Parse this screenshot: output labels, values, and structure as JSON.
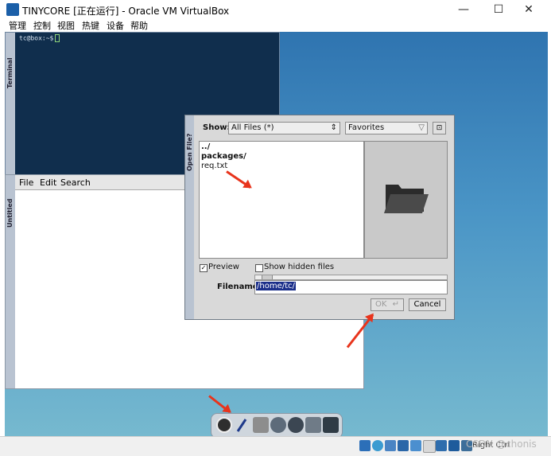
{
  "window": {
    "title": "TINYCORE [正在运行] - Oracle VM VirtualBox",
    "minimize": "—",
    "maximize": "☐",
    "close": "✕"
  },
  "menubar": [
    "管理",
    "控制",
    "视图",
    "热键",
    "设备",
    "帮助"
  ],
  "terminal": {
    "side_label": "Terminal",
    "prompt": "tc@box:~$"
  },
  "editor": {
    "side_label": "Untitled",
    "menu": [
      "File",
      "Edit",
      "Search"
    ]
  },
  "dialog": {
    "side_label": "Open File?",
    "show_label": "Show:",
    "show_value": "All Files (*)",
    "favorites": "Favorites",
    "files": [
      "../",
      "packages/",
      "req.txt"
    ],
    "preview_label": "Preview",
    "preview_checked": true,
    "hidden_label": "Show hidden files",
    "hidden_checked": false,
    "filename_label": "Filename:",
    "filename_value": "/home/tc/",
    "ok_label": "OK",
    "cancel_label": "Cancel"
  },
  "statusbar": {
    "host_key": "Right Ctrl",
    "watermark": "CSDN @chonis"
  },
  "colors": {
    "annotation_arrow": "#e8341c",
    "desktop_top": "#2f74b0",
    "desktop_bottom": "#76b9cf"
  }
}
